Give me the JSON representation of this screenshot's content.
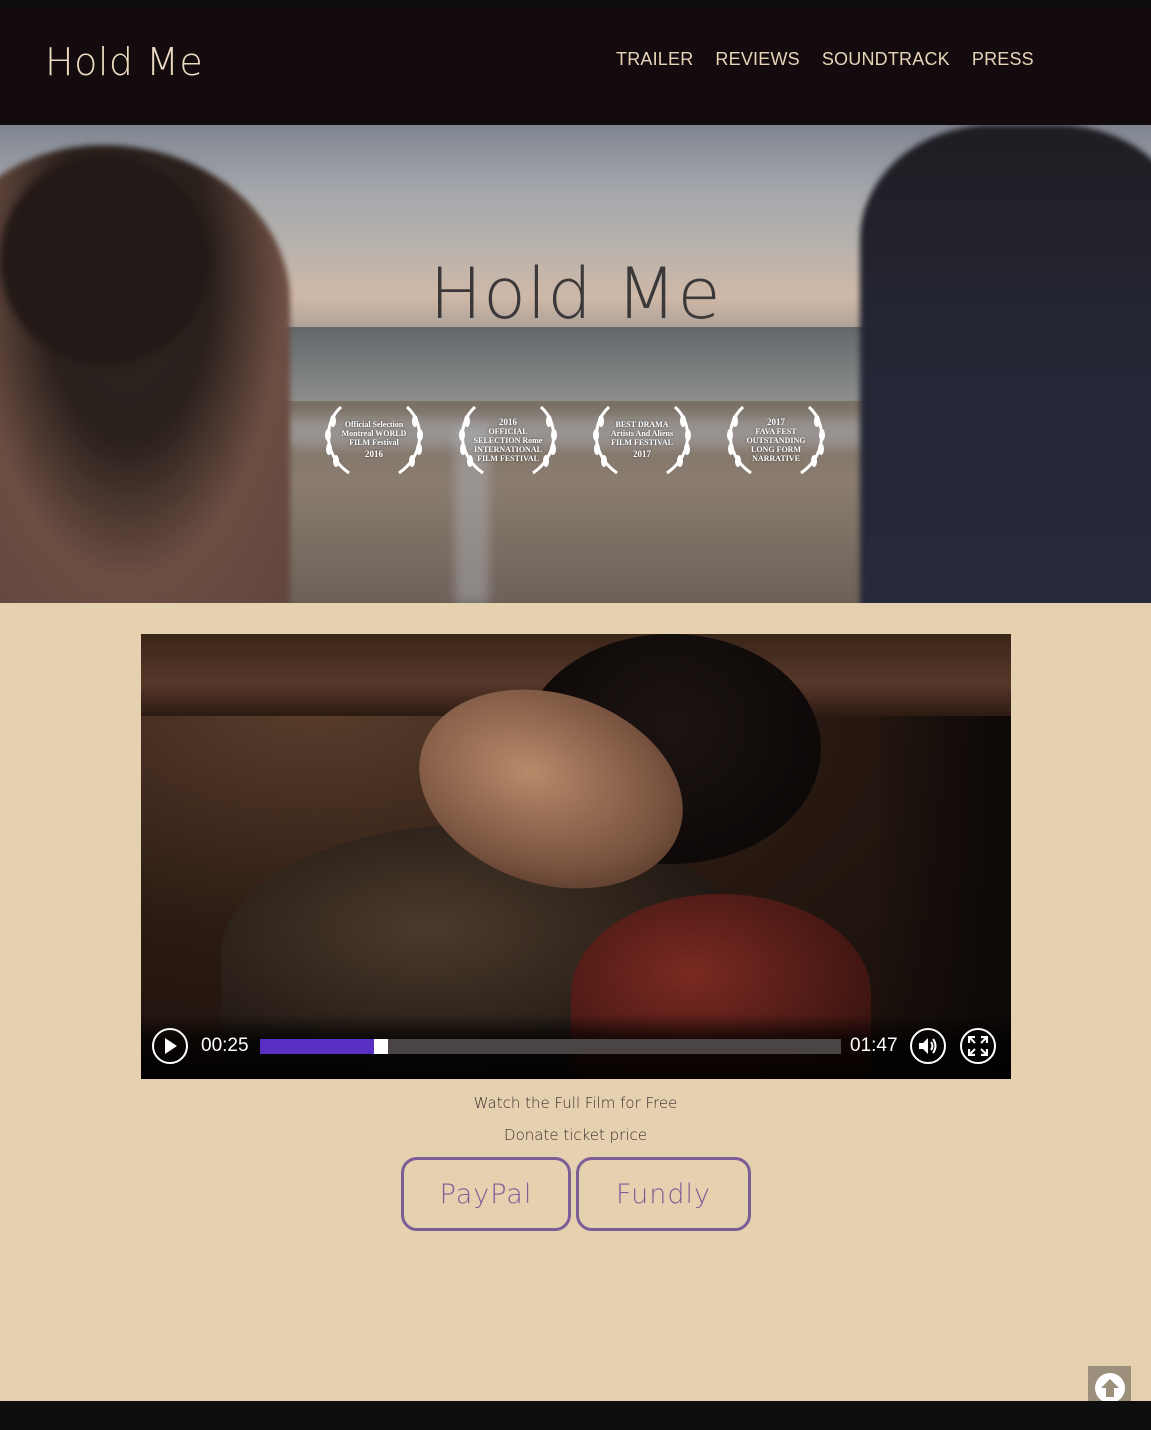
{
  "header": {
    "site_title": "Hold Me",
    "nav": [
      "TRAILER",
      "REVIEWS",
      "SOUNDTRACK",
      "PRESS"
    ]
  },
  "hero": {
    "title": "Hold Me",
    "laurels": [
      {
        "top": "Official Selection",
        "main": "Montreal WORLD FILM Festival",
        "year": "2016"
      },
      {
        "top": "2016",
        "main": "OFFICIAL SELECTION Rome INTERNATIONAL FILM FESTIVAL",
        "year": ""
      },
      {
        "top": "BEST DRAMA",
        "main": "Artists And Aliens FILM FESTIVAL",
        "year": "2017"
      },
      {
        "top": "2017",
        "main": "FAVA FEST OUTSTANDING LONG FORM NARRATIVE",
        "year": ""
      }
    ]
  },
  "video": {
    "current_time": "00:25",
    "duration": "01:47",
    "progress": 0.2,
    "accent_color": "#5a2fc4"
  },
  "cta": {
    "watch_text": "Watch the Full Film for Free",
    "donate_text": "Donate ticket price",
    "buttons": [
      "PayPal",
      "Fundly"
    ]
  },
  "icons": {
    "play": "play-icon",
    "volume": "volume-icon",
    "fullscreen": "fullscreen-icon",
    "scroll_top": "arrow-up-circle-icon"
  }
}
